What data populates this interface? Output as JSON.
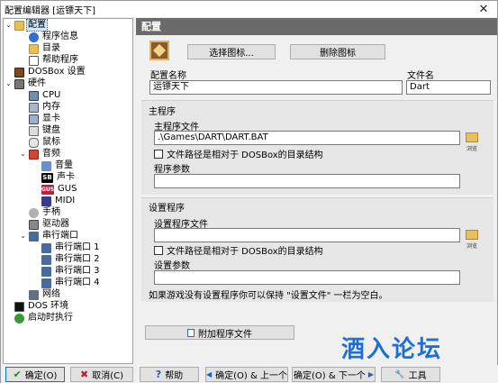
{
  "window": {
    "title": "配置编辑器 [运镖天下]",
    "close_glyph": "✕"
  },
  "tree": {
    "items": [
      {
        "label": "配置",
        "expander": "⌄",
        "icon": "config-icon"
      },
      {
        "label": "程序信息",
        "icon": "info-icon"
      },
      {
        "label": "目录",
        "icon": "folder-icon"
      },
      {
        "label": "帮助程序",
        "icon": "document-icon"
      },
      {
        "label": "DOSBox 设置",
        "icon": "dosbox-icon"
      },
      {
        "label": "硬件",
        "expander": "⌄",
        "icon": "hardware-icon"
      },
      {
        "label": "CPU",
        "icon": "cpu-icon"
      },
      {
        "label": "内存",
        "icon": "memory-icon"
      },
      {
        "label": "显卡",
        "icon": "graphics-card-icon"
      },
      {
        "label": "键盘",
        "icon": "keyboard-icon"
      },
      {
        "label": "鼠标",
        "icon": "mouse-icon"
      },
      {
        "label": "音频",
        "expander": "⌄",
        "icon": "speaker-icon"
      },
      {
        "label": "音量",
        "icon": "volume-icon"
      },
      {
        "label": "声卡",
        "icon": "sound-blaster-icon",
        "icon_text": "SB"
      },
      {
        "label": "GUS",
        "icon": "gus-icon",
        "icon_text": "GUS"
      },
      {
        "label": "MIDI",
        "icon": "midi-icon"
      },
      {
        "label": "手柄",
        "icon": "joystick-icon"
      },
      {
        "label": "驱动器",
        "icon": "drive-icon"
      },
      {
        "label": "串行端口",
        "expander": "⌄",
        "icon": "serial-port-icon"
      },
      {
        "label": "串行端口 1",
        "icon": "serial-port-icon"
      },
      {
        "label": "串行端口 2",
        "icon": "serial-port-icon"
      },
      {
        "label": "串行端口 3",
        "icon": "serial-port-icon"
      },
      {
        "label": "串行端口 4",
        "icon": "serial-port-icon"
      },
      {
        "label": "网络",
        "icon": "network-icon"
      },
      {
        "label": "DOS 环境",
        "icon": "dos-environment-icon"
      },
      {
        "label": "启动时执行",
        "icon": "autorun-icon"
      }
    ]
  },
  "panel": {
    "header": "配置",
    "select_icon_button": "选择图标...",
    "delete_icon_button": "删除图标",
    "config_name_label": "配置名称",
    "config_name_value": "运镖天下",
    "file_name_label": "文件名",
    "file_name_value": "Dart",
    "main_section": {
      "title": "主程序",
      "file_label": "主程序文件",
      "file_value": ".\\Games\\DART\\DART.BAT",
      "relative_checkbox": "文件路径是相对于 DOSBox的目录结构",
      "params_label": "程序参数",
      "params_value": "",
      "browse_label": "浏览"
    },
    "setup_section": {
      "title": "设置程序",
      "file_label": "设置程序文件",
      "file_value": "",
      "relative_checkbox": "文件路径是相对于 DOSBox的目录结构",
      "params_label": "设置参数",
      "params_value": "",
      "browse_label": "浏览",
      "note": "如果游戏没有设置程序你可以保持 \"设置文件\" 一栏为空白。"
    },
    "attach_button": "附加程序文件"
  },
  "watermark": "酒入论坛",
  "bottom_bar": {
    "ok": {
      "label": "确定(O)",
      "icon": "✔"
    },
    "cancel": {
      "label": "取消(C)",
      "icon": "✖"
    },
    "help": {
      "label": "帮助",
      "icon": "?"
    },
    "ok_prev": {
      "label": "确定(O) & 上一个",
      "icon": "◀"
    },
    "ok_next": {
      "label": "确定(O) & 下一个",
      "icon": "▶"
    },
    "tools": {
      "label": "工具",
      "icon": "🔧"
    }
  }
}
